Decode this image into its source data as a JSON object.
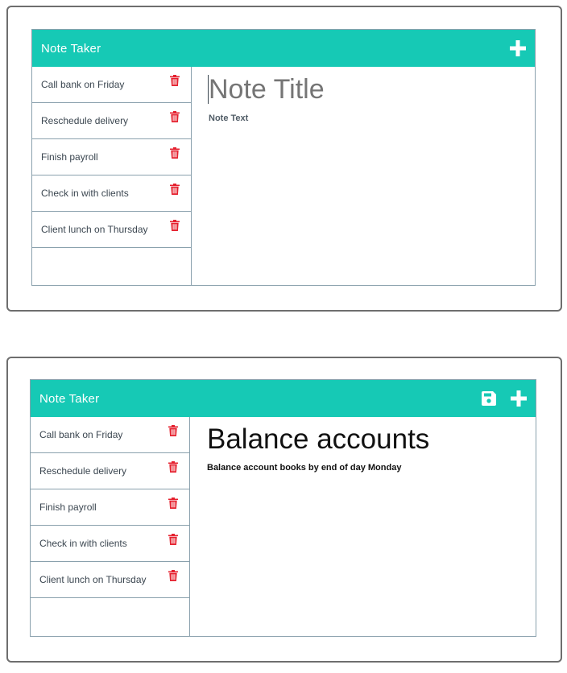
{
  "screen1": {
    "brand": "Note Taker",
    "notes": [
      {
        "label": "Call bank on Friday"
      },
      {
        "label": "Reschedule delivery"
      },
      {
        "label": "Finish payroll"
      },
      {
        "label": "Check in with clients"
      },
      {
        "label": "Client lunch on Thursday"
      }
    ],
    "editor": {
      "title_placeholder": "Note Title",
      "text_placeholder": "Note Text"
    }
  },
  "screen2": {
    "brand": "Note Taker",
    "notes": [
      {
        "label": "Call bank on Friday"
      },
      {
        "label": "Reschedule delivery"
      },
      {
        "label": "Finish payroll"
      },
      {
        "label": "Check in with clients"
      },
      {
        "label": "Client lunch on Thursday"
      }
    ],
    "editor": {
      "title": "Balance accounts",
      "text": "Balance account books by end of day Monday"
    }
  },
  "icons": {
    "add": "plus-icon",
    "save": "save-icon",
    "delete": "trash-icon"
  },
  "colors": {
    "navbar": "#16c9b5",
    "delete": "#e5202e",
    "border": "#8aa1ad"
  }
}
